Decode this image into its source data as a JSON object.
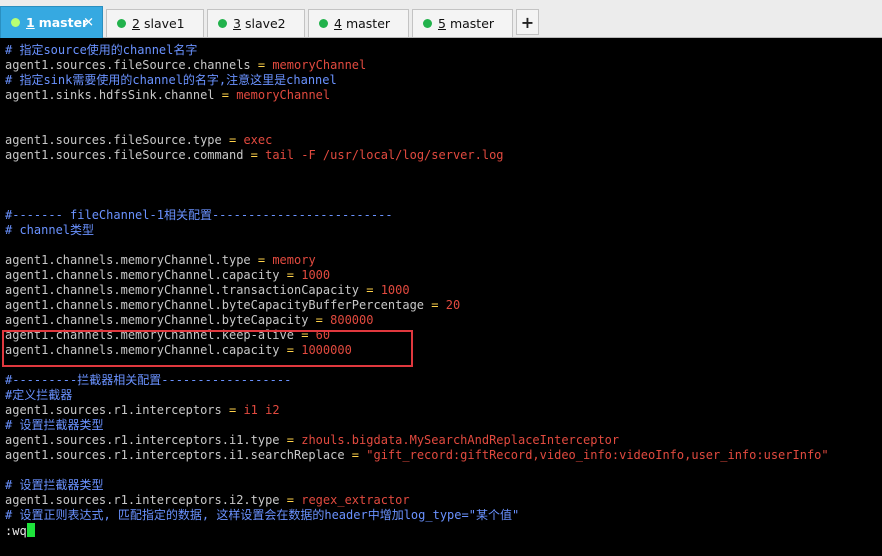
{
  "tabs": [
    {
      "num": "1",
      "name": "master",
      "active": true,
      "close": "✕"
    },
    {
      "num": "2",
      "name": "slave1",
      "active": false
    },
    {
      "num": "3",
      "name": "slave2",
      "active": false
    },
    {
      "num": "4",
      "name": "master",
      "active": false
    },
    {
      "num": "5",
      "name": "master",
      "active": false
    }
  ],
  "add_tab_label": "+",
  "colors": {
    "comment": "#6a92ff",
    "equals": "#ffd24a",
    "value": "#e24a3f",
    "text": "#c8c8c8",
    "highlight_box": "#e0383e",
    "cursor": "#1ee43b",
    "tab_active": "#36a9e1"
  },
  "lines": [
    {
      "type": "comment",
      "text": "# 指定source使用的channel名字"
    },
    {
      "type": "kv",
      "key": "agent1.sources.fileSource.channels",
      "value": "memoryChannel"
    },
    {
      "type": "comment",
      "text": "# 指定sink需要使用的channel的名字,注意这里是channel"
    },
    {
      "type": "kv",
      "key": "agent1.sinks.hdfsSink.channel",
      "value": "memoryChannel"
    },
    {
      "type": "blank"
    },
    {
      "type": "blank"
    },
    {
      "type": "kv",
      "key": "agent1.sources.fileSource.type",
      "value": "exec"
    },
    {
      "type": "kv",
      "key": "agent1.sources.fileSource.command",
      "value": "tail -F /usr/local/log/server.log"
    },
    {
      "type": "blank"
    },
    {
      "type": "blank"
    },
    {
      "type": "blank"
    },
    {
      "type": "comment",
      "text": "#------- fileChannel-1相关配置-------------------------"
    },
    {
      "type": "comment",
      "text": "# channel类型"
    },
    {
      "type": "blank"
    },
    {
      "type": "kv",
      "key": "agent1.channels.memoryChannel.type",
      "value": "memory"
    },
    {
      "type": "kv",
      "key": "agent1.channels.memoryChannel.capacity",
      "value": "1000"
    },
    {
      "type": "kv",
      "key": "agent1.channels.memoryChannel.transactionCapacity",
      "value": "1000"
    },
    {
      "type": "kv",
      "key": "agent1.channels.memoryChannel.byteCapacityBufferPercentage",
      "value": "20"
    },
    {
      "type": "kv",
      "key": "agent1.channels.memoryChannel.byteCapacity",
      "value": "800000"
    },
    {
      "type": "kv",
      "key": "agent1.channels.memoryChannel.keep-alive",
      "value": "60"
    },
    {
      "type": "kv",
      "key": "agent1.channels.memoryChannel.capacity",
      "value": "1000000"
    },
    {
      "type": "blank"
    },
    {
      "type": "comment",
      "text": "#---------拦截器相关配置------------------"
    },
    {
      "type": "comment",
      "text": "#定义拦截器"
    },
    {
      "type": "kv",
      "key": "agent1.sources.r1.interceptors",
      "value": "i1 i2"
    },
    {
      "type": "comment",
      "text": "# 设置拦截器类型"
    },
    {
      "type": "kv",
      "key": "agent1.sources.r1.interceptors.i1.type",
      "value": "zhouls.bigdata.MySearchAndReplaceInterceptor"
    },
    {
      "type": "kv",
      "key": "agent1.sources.r1.interceptors.i1.searchReplace",
      "value": "\"gift_record:giftRecord,video_info:videoInfo,user_info:userInfo\""
    },
    {
      "type": "blank"
    },
    {
      "type": "comment",
      "text": "# 设置拦截器类型"
    },
    {
      "type": "kv",
      "key": "agent1.sources.r1.interceptors.i2.type",
      "value": "regex_extractor"
    },
    {
      "type": "comment",
      "text": "# 设置正则表达式, 匹配指定的数据, 这样设置会在数据的header中增加log_type=\"某个值\""
    }
  ],
  "command_line": ":wq"
}
